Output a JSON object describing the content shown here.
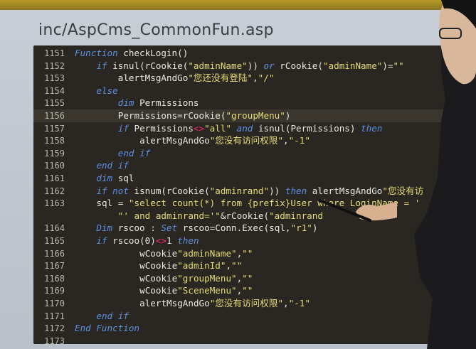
{
  "header": {
    "file_title": "inc/AspCms_CommonFun.asp"
  },
  "code": {
    "lines": [
      {
        "num": "1151",
        "text": "Function checkLogin()"
      },
      {
        "num": "1152",
        "text": "    if isnul(rCookie(\"adminName\")) or rCookie(\"adminName\")=\"\""
      },
      {
        "num": "1153",
        "text": "        alertMsgAndGo\"您还没有登陆\",\"/\""
      },
      {
        "num": "1154",
        "text": "    else"
      },
      {
        "num": "1155",
        "text": "        dim Permissions"
      },
      {
        "num": "1156",
        "text": "        Permissions=rCookie(\"groupMenu\")"
      },
      {
        "num": "1157",
        "text": "        if Permissions<>\"all\" and isnul(Permissions) then"
      },
      {
        "num": "1158",
        "text": "            alertMsgAndGo\"您没有访问权限\",\"-1\""
      },
      {
        "num": "1159",
        "text": "        end if"
      },
      {
        "num": "1160",
        "text": "    end if"
      },
      {
        "num": "1161",
        "text": "    dim sql"
      },
      {
        "num": "1162",
        "text": "    if not isnum(rCookie(\"adminrand\")) then alertMsgAndGo\"您没有访"
      },
      {
        "num": "1163",
        "text": "    sql = \"select count(*) from {prefix}User where LoginName = '"
      },
      {
        "num": "",
        "text": "        \"' and adminrand='\"&rCookie(\"adminrand"
      },
      {
        "num": "1164",
        "text": "    Dim rscoo : Set rscoo=Conn.Exec(sql,\"r1\")"
      },
      {
        "num": "1165",
        "text": "    if rscoo(0)<>1 then"
      },
      {
        "num": "1166",
        "text": "            wCookie\"adminName\",\"\""
      },
      {
        "num": "1167",
        "text": "            wCookie\"adminId\",\"\""
      },
      {
        "num": "1168",
        "text": "            wCookie\"groupMenu\",\"\""
      },
      {
        "num": "1169",
        "text": "            wCookie\"SceneMenu\",\"\""
      },
      {
        "num": "1170",
        "text": "            alertMsgAndGo\"您没有访问权限\",\"-1\""
      },
      {
        "num": "1171",
        "text": "    end if"
      },
      {
        "num": "1172",
        "text": "End Function"
      },
      {
        "num": "1173",
        "text": ""
      }
    ]
  }
}
